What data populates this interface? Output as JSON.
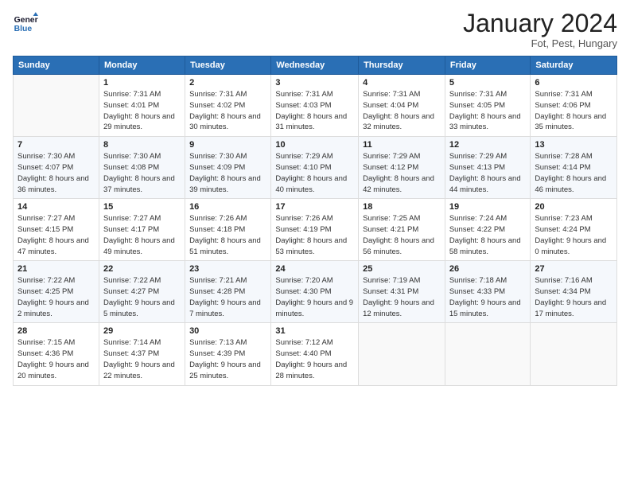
{
  "header": {
    "logo_line1": "General",
    "logo_line2": "Blue",
    "month": "January 2024",
    "location": "Fot, Pest, Hungary"
  },
  "columns": [
    "Sunday",
    "Monday",
    "Tuesday",
    "Wednesday",
    "Thursday",
    "Friday",
    "Saturday"
  ],
  "weeks": [
    [
      {
        "day": "",
        "info": ""
      },
      {
        "day": "1",
        "info": "Sunrise: 7:31 AM\nSunset: 4:01 PM\nDaylight: 8 hours\nand 29 minutes."
      },
      {
        "day": "2",
        "info": "Sunrise: 7:31 AM\nSunset: 4:02 PM\nDaylight: 8 hours\nand 30 minutes."
      },
      {
        "day": "3",
        "info": "Sunrise: 7:31 AM\nSunset: 4:03 PM\nDaylight: 8 hours\nand 31 minutes."
      },
      {
        "day": "4",
        "info": "Sunrise: 7:31 AM\nSunset: 4:04 PM\nDaylight: 8 hours\nand 32 minutes."
      },
      {
        "day": "5",
        "info": "Sunrise: 7:31 AM\nSunset: 4:05 PM\nDaylight: 8 hours\nand 33 minutes."
      },
      {
        "day": "6",
        "info": "Sunrise: 7:31 AM\nSunset: 4:06 PM\nDaylight: 8 hours\nand 35 minutes."
      }
    ],
    [
      {
        "day": "7",
        "info": "Sunrise: 7:30 AM\nSunset: 4:07 PM\nDaylight: 8 hours\nand 36 minutes."
      },
      {
        "day": "8",
        "info": "Sunrise: 7:30 AM\nSunset: 4:08 PM\nDaylight: 8 hours\nand 37 minutes."
      },
      {
        "day": "9",
        "info": "Sunrise: 7:30 AM\nSunset: 4:09 PM\nDaylight: 8 hours\nand 39 minutes."
      },
      {
        "day": "10",
        "info": "Sunrise: 7:29 AM\nSunset: 4:10 PM\nDaylight: 8 hours\nand 40 minutes."
      },
      {
        "day": "11",
        "info": "Sunrise: 7:29 AM\nSunset: 4:12 PM\nDaylight: 8 hours\nand 42 minutes."
      },
      {
        "day": "12",
        "info": "Sunrise: 7:29 AM\nSunset: 4:13 PM\nDaylight: 8 hours\nand 44 minutes."
      },
      {
        "day": "13",
        "info": "Sunrise: 7:28 AM\nSunset: 4:14 PM\nDaylight: 8 hours\nand 46 minutes."
      }
    ],
    [
      {
        "day": "14",
        "info": "Sunrise: 7:27 AM\nSunset: 4:15 PM\nDaylight: 8 hours\nand 47 minutes."
      },
      {
        "day": "15",
        "info": "Sunrise: 7:27 AM\nSunset: 4:17 PM\nDaylight: 8 hours\nand 49 minutes."
      },
      {
        "day": "16",
        "info": "Sunrise: 7:26 AM\nSunset: 4:18 PM\nDaylight: 8 hours\nand 51 minutes."
      },
      {
        "day": "17",
        "info": "Sunrise: 7:26 AM\nSunset: 4:19 PM\nDaylight: 8 hours\nand 53 minutes."
      },
      {
        "day": "18",
        "info": "Sunrise: 7:25 AM\nSunset: 4:21 PM\nDaylight: 8 hours\nand 56 minutes."
      },
      {
        "day": "19",
        "info": "Sunrise: 7:24 AM\nSunset: 4:22 PM\nDaylight: 8 hours\nand 58 minutes."
      },
      {
        "day": "20",
        "info": "Sunrise: 7:23 AM\nSunset: 4:24 PM\nDaylight: 9 hours\nand 0 minutes."
      }
    ],
    [
      {
        "day": "21",
        "info": "Sunrise: 7:22 AM\nSunset: 4:25 PM\nDaylight: 9 hours\nand 2 minutes."
      },
      {
        "day": "22",
        "info": "Sunrise: 7:22 AM\nSunset: 4:27 PM\nDaylight: 9 hours\nand 5 minutes."
      },
      {
        "day": "23",
        "info": "Sunrise: 7:21 AM\nSunset: 4:28 PM\nDaylight: 9 hours\nand 7 minutes."
      },
      {
        "day": "24",
        "info": "Sunrise: 7:20 AM\nSunset: 4:30 PM\nDaylight: 9 hours\nand 9 minutes."
      },
      {
        "day": "25",
        "info": "Sunrise: 7:19 AM\nSunset: 4:31 PM\nDaylight: 9 hours\nand 12 minutes."
      },
      {
        "day": "26",
        "info": "Sunrise: 7:18 AM\nSunset: 4:33 PM\nDaylight: 9 hours\nand 15 minutes."
      },
      {
        "day": "27",
        "info": "Sunrise: 7:16 AM\nSunset: 4:34 PM\nDaylight: 9 hours\nand 17 minutes."
      }
    ],
    [
      {
        "day": "28",
        "info": "Sunrise: 7:15 AM\nSunset: 4:36 PM\nDaylight: 9 hours\nand 20 minutes."
      },
      {
        "day": "29",
        "info": "Sunrise: 7:14 AM\nSunset: 4:37 PM\nDaylight: 9 hours\nand 22 minutes."
      },
      {
        "day": "30",
        "info": "Sunrise: 7:13 AM\nSunset: 4:39 PM\nDaylight: 9 hours\nand 25 minutes."
      },
      {
        "day": "31",
        "info": "Sunrise: 7:12 AM\nSunset: 4:40 PM\nDaylight: 9 hours\nand 28 minutes."
      },
      {
        "day": "",
        "info": ""
      },
      {
        "day": "",
        "info": ""
      },
      {
        "day": "",
        "info": ""
      }
    ]
  ]
}
